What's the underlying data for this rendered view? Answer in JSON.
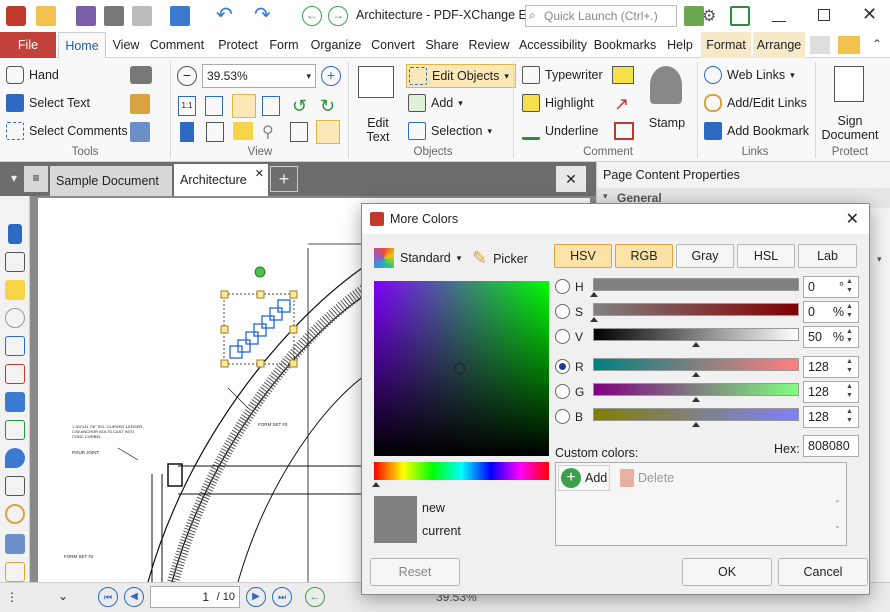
{
  "window": {
    "title": "Architecture - PDF-XChange E...",
    "search_placeholder": "Quick Launch (Ctrl+.)"
  },
  "menu": {
    "tabs": [
      "File",
      "Home",
      "View",
      "Comment",
      "Protect",
      "Form",
      "Organize",
      "Convert",
      "Share",
      "Review",
      "Accessibility",
      "Bookmarks",
      "Help",
      "Format",
      "Arrange"
    ],
    "active": "Home"
  },
  "ribbon": {
    "tools": {
      "hand": "Hand",
      "select_text": "Select Text",
      "select_comments": "Select Comments",
      "label": "Tools"
    },
    "view": {
      "zoom": "39.53%",
      "label": "View"
    },
    "objects": {
      "edit_objects": "Edit Objects",
      "add": "Add",
      "selection": "Selection",
      "edit_text": "Edit Text",
      "label": "Objects"
    },
    "comment": {
      "typewriter": "Typewriter",
      "highlight": "Highlight",
      "underline": "Underline",
      "stamp": "Stamp",
      "label": "Comment"
    },
    "links": {
      "web_links": "Web Links",
      "add_edit_links": "Add/Edit Links",
      "add_bookmark": "Add Bookmark",
      "label": "Links"
    },
    "protect": {
      "sign_document": "Sign Document",
      "label": "Protect"
    }
  },
  "doc_tabs": [
    "Sample Document",
    "Architecture"
  ],
  "right_panel": {
    "title": "Page Content Properties",
    "section": "General"
  },
  "drawing_labels": {
    "label1": "1 3/4\"x11 7/8\" SCL 'CURVED' LEDGER, C/W ANCHOR BOLTS CAST INTO CONC CORBEL",
    "pour_joint": "POUR JOINT",
    "form_set_3": "FORM SET #3",
    "form_set_2": "FORM SET #2"
  },
  "status": {
    "page": "1",
    "total": "/ 10",
    "zoom": "39.53%"
  },
  "dialog": {
    "title": "More Colors",
    "standard": "Standard",
    "picker": "Picker",
    "tabs": [
      "HSV",
      "RGB",
      "Gray",
      "HSL",
      "Lab"
    ],
    "active_tab": "HSV",
    "channels": [
      {
        "key": "H",
        "value": "0",
        "unit": "°"
      },
      {
        "key": "S",
        "value": "0",
        "unit": "%"
      },
      {
        "key": "V",
        "value": "50",
        "unit": "%"
      },
      {
        "key": "R",
        "value": "128",
        "unit": ""
      },
      {
        "key": "G",
        "value": "128",
        "unit": ""
      },
      {
        "key": "B",
        "value": "128",
        "unit": ""
      }
    ],
    "selected_channel": "R",
    "hex_label": "Hex:",
    "hex": "808080",
    "custom_colors": "Custom colors:",
    "add": "Add",
    "delete": "Delete",
    "new": "new",
    "current": "current",
    "reset": "Reset",
    "ok": "OK",
    "cancel": "Cancel",
    "preview_color": "#808080"
  }
}
